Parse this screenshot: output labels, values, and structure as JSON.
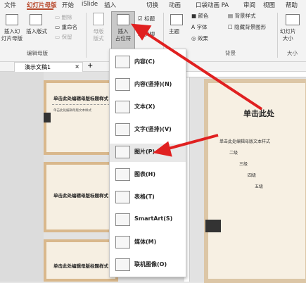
{
  "tabs": [
    "文件",
    "幻灯片母版",
    "开始",
    "iSlide",
    "插入",
    "切换",
    "动画",
    "口袋动画 PA",
    "审阅",
    "视图",
    "帮助"
  ],
  "ribbon": {
    "insert_slide_master": "插入幻\n灯片母版",
    "insert_layout": "插入版式",
    "delete": "删除",
    "rename": "重命名",
    "preserve": "保留",
    "master_layout": "母版\n版式",
    "insert_placeholder": "插入\n占位符",
    "title_checkbox": "标题",
    "footer_checkbox": "页脚",
    "theme": "主题",
    "colors": "颜色",
    "fonts": "字体",
    "effects": "效果",
    "bg_styles": "背景样式",
    "hide_bg": "隐藏背景图形",
    "slide_size": "幻灯片\n大小",
    "group_edit_master": "编辑母版",
    "group_background": "背景",
    "group_size": "大小"
  },
  "document_tab": "演示文稿1",
  "menu_items": [
    {
      "label": "内容(C)",
      "icon": "content-icon"
    },
    {
      "label": "内容(竖排)(N)",
      "icon": "content-vertical-icon"
    },
    {
      "label": "文本(X)",
      "icon": "text-icon"
    },
    {
      "label": "文字(竖排)(V)",
      "icon": "text-vertical-icon"
    },
    {
      "label": "图片(P)",
      "icon": "picture-icon"
    },
    {
      "label": "图表(H)",
      "icon": "chart-icon"
    },
    {
      "label": "表格(T)",
      "icon": "table-icon"
    },
    {
      "label": "SmartArt(S)",
      "icon": "smartart-icon"
    },
    {
      "label": "媒体(M)",
      "icon": "media-icon"
    },
    {
      "label": "联机图像(O)",
      "icon": "online-image-icon"
    }
  ],
  "thumbs": [
    {
      "title": "单击此处编辑母版标题样式",
      "text": "单击此处编辑母版文本样式"
    },
    {
      "title": "单击此处编辑母版标题样式",
      "text": ""
    },
    {
      "title": "单击此处编辑母版标题样式",
      "text": ""
    }
  ],
  "slide": {
    "title": "单击此处",
    "body": [
      "单击此处编辑母版文本样式",
      "二级",
      "三级",
      "四级",
      "五级"
    ]
  },
  "accent_color": "#b7472a",
  "arrow_color": "#e02020"
}
